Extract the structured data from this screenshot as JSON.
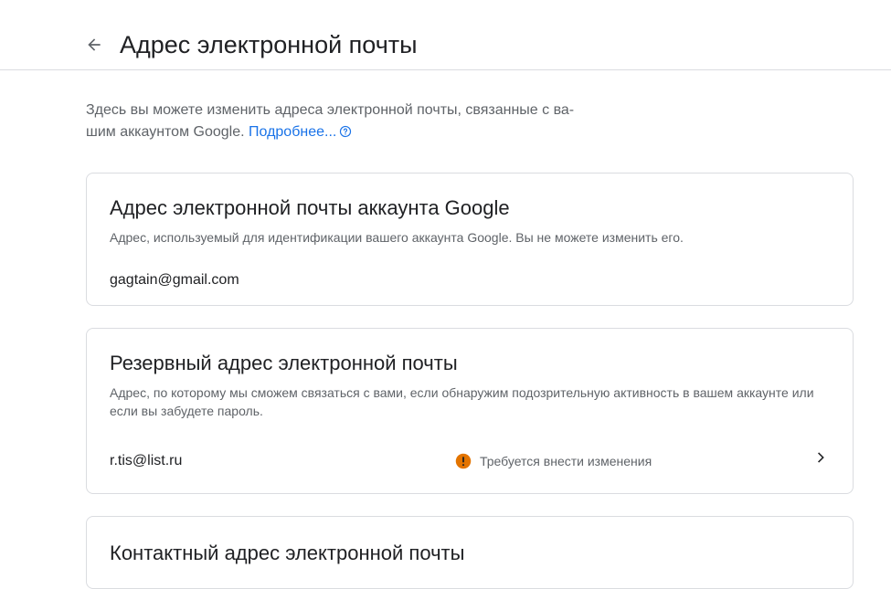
{
  "header": {
    "title": "Адрес электронной почты",
    "back_icon": "arrow-back-icon"
  },
  "intro": {
    "text": "Здесь вы можете изменить адреса электронной почты, связанные с ва-шим аккаунтом Google.",
    "text_line1": "Здесь вы можете изменить адреса электронной почты, связанные с ва-",
    "text_line2": "шим аккаунтом Google.",
    "link_label": "Подробнее...",
    "help_icon": "help-circle-icon"
  },
  "cards": [
    {
      "title": "Адрес электронной почты аккаунта Google",
      "description": "Адрес, используемый для идентификации вашего аккаунта Google. Вы не можете изменить его.",
      "value": "gagtain@gmail.com"
    },
    {
      "title": "Резервный адрес электронной почты",
      "description_line1": "Адрес, по которому мы сможем связаться с вами, если обнаружим подозрительную активность в вашем аккаунте или",
      "description_line2": "если вы забудете пароль.",
      "value": "r.tis@list.ru",
      "status": "Требуется внести изменения",
      "status_icon": "warning-icon",
      "status_color": "#e37400"
    },
    {
      "title": "Контактный адрес электронной почты"
    }
  ],
  "colors": {
    "link": "#1a73e8",
    "border": "#dadce0",
    "secondary_text": "#5f6368",
    "warning": "#e37400"
  }
}
